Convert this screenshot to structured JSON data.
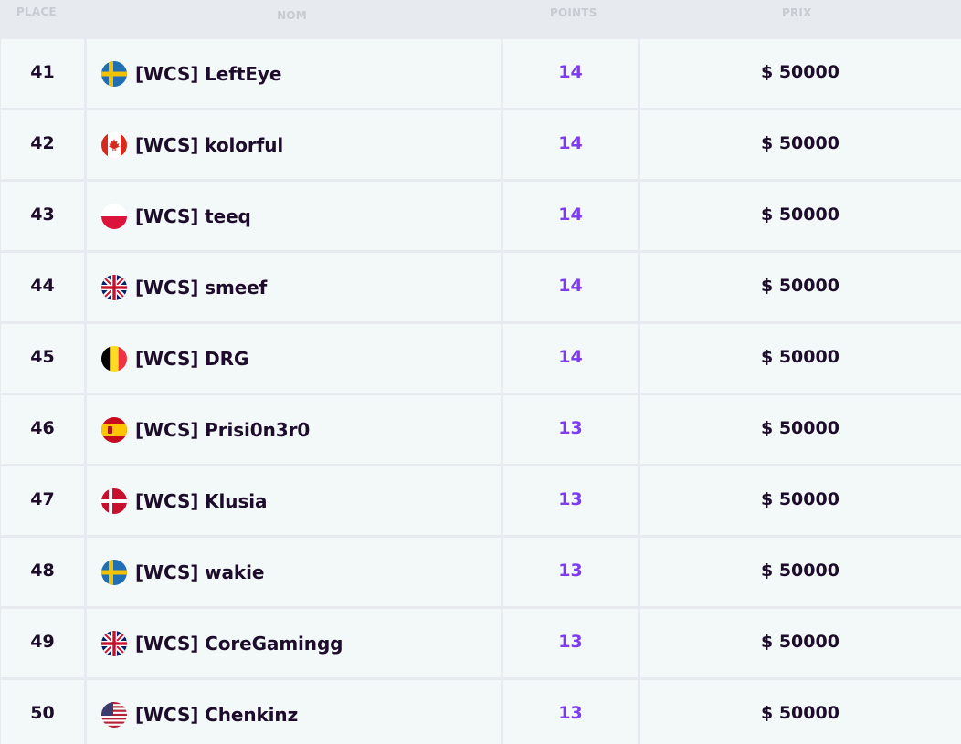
{
  "header": {
    "place_label": "PLACE",
    "name_label": "NOM",
    "points_label": "POINTS",
    "prize_label": "PRIX"
  },
  "colors": {
    "points": "#7d3cf0",
    "text_dark": "#1d0c2b",
    "row_bg": "#f3f8f8",
    "grid_bg": "#e7ebef"
  },
  "rows": [
    {
      "place": "41",
      "name": "[WCS] LeftEye",
      "points": "14",
      "prize": "$ 50000",
      "flag": "sweden-flag-icon"
    },
    {
      "place": "42",
      "name": "[WCS] kolorful",
      "points": "14",
      "prize": "$ 50000",
      "flag": "canada-flag-icon"
    },
    {
      "place": "43",
      "name": "[WCS] teeq",
      "points": "14",
      "prize": "$ 50000",
      "flag": "poland-flag-icon"
    },
    {
      "place": "44",
      "name": "[WCS] smeef",
      "points": "14",
      "prize": "$ 50000",
      "flag": "uk-flag-icon"
    },
    {
      "place": "45",
      "name": "[WCS] DRG",
      "points": "14",
      "prize": "$ 50000",
      "flag": "belgium-flag-icon"
    },
    {
      "place": "46",
      "name": "[WCS] Prisi0n3r0",
      "points": "13",
      "prize": "$ 50000",
      "flag": "spain-flag-icon"
    },
    {
      "place": "47",
      "name": "[WCS] Klusia",
      "points": "13",
      "prize": "$ 50000",
      "flag": "denmark-flag-icon"
    },
    {
      "place": "48",
      "name": "[WCS] wakie",
      "points": "13",
      "prize": "$ 50000",
      "flag": "sweden-flag-icon"
    },
    {
      "place": "49",
      "name": "[WCS] CoreGamingg",
      "points": "13",
      "prize": "$ 50000",
      "flag": "uk-flag-icon"
    },
    {
      "place": "50",
      "name": "[WCS] Chenkinz",
      "points": "13",
      "prize": "$ 50000",
      "flag": "usa-flag-icon"
    }
  ]
}
